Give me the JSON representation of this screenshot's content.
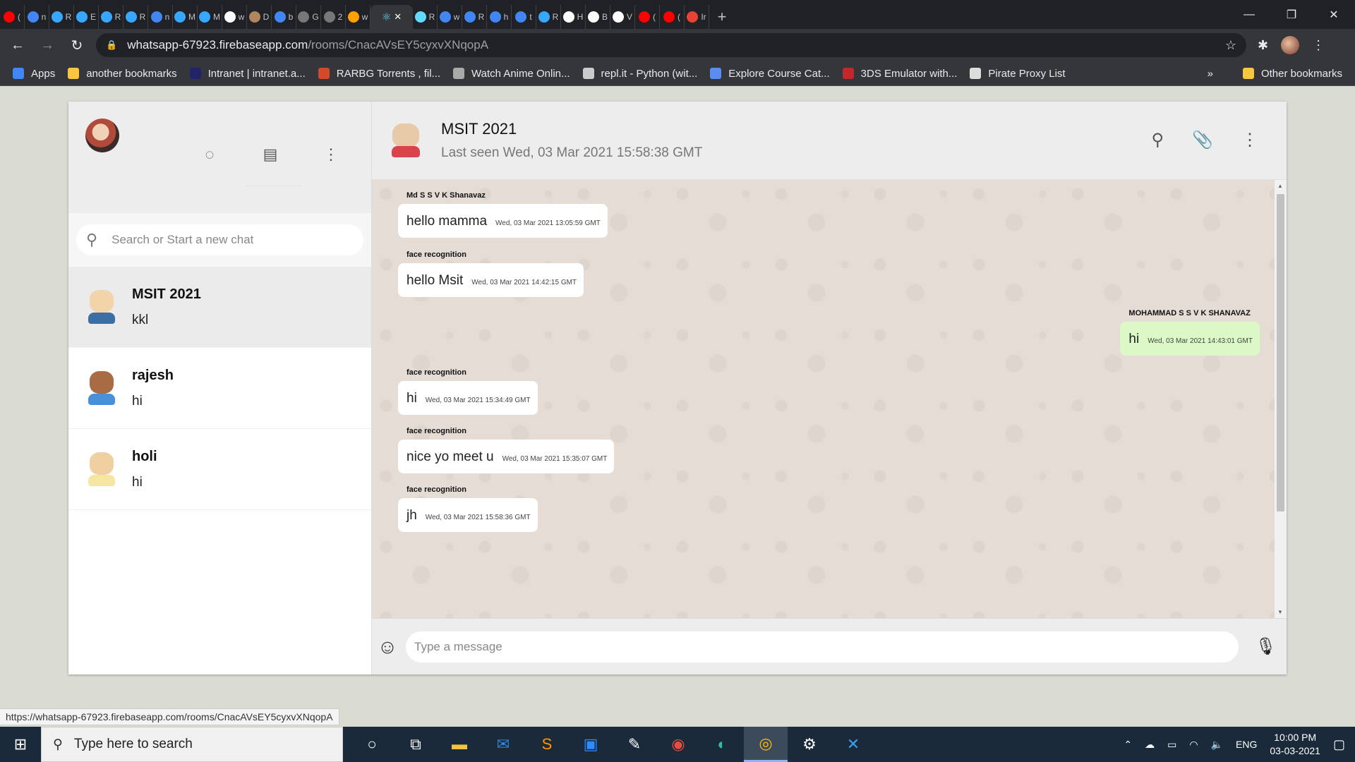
{
  "browser": {
    "tabs": [
      {
        "label": "(",
        "color": "#ff0000"
      },
      {
        "label": "n",
        "color": "#4285f4"
      },
      {
        "label": "R",
        "color": "#36a8ff"
      },
      {
        "label": "E",
        "color": "#36a8ff"
      },
      {
        "label": "R",
        "color": "#36a8ff"
      },
      {
        "label": "R",
        "color": "#36a8ff"
      },
      {
        "label": "n",
        "color": "#4285f4"
      },
      {
        "label": "M",
        "color": "#36a8ff"
      },
      {
        "label": "M",
        "color": "#36a8ff"
      },
      {
        "label": "w",
        "color": "#ffffff"
      },
      {
        "label": "D",
        "color": "#b0855f"
      },
      {
        "label": "b",
        "color": "#4285f4"
      },
      {
        "label": "G",
        "color": "#777777"
      },
      {
        "label": "2",
        "color": "#777777"
      },
      {
        "label": "w",
        "color": "#ffa000"
      }
    ],
    "active_tab": {
      "icon": "react-icon",
      "close": "✕"
    },
    "tabs_after": [
      {
        "label": "R",
        "color": "#61dafb"
      },
      {
        "label": "w",
        "color": "#4285f4"
      },
      {
        "label": "R",
        "color": "#4285f4"
      },
      {
        "label": "h",
        "color": "#4285f4"
      },
      {
        "label": "t",
        "color": "#4285f4"
      },
      {
        "label": "R",
        "color": "#36a8ff"
      },
      {
        "label": "H",
        "color": "#ffffff"
      },
      {
        "label": "B",
        "color": "#ffffff"
      },
      {
        "label": "V",
        "color": "#ffffff"
      },
      {
        "label": "(",
        "color": "#ff0000"
      },
      {
        "label": "(",
        "color": "#ff0000"
      },
      {
        "label": "Ir",
        "color": "#ea4335"
      }
    ],
    "new_tab": "+",
    "window_controls": [
      "—",
      "❐",
      "✕"
    ],
    "url_host": "whatsapp-67923.firebaseapp.com",
    "url_path": "/rooms/CnacAVsEY5cyxvXNqopA",
    "bookmarks": [
      {
        "label": "Apps",
        "color": "#4285f4"
      },
      {
        "label": "another bookmarks",
        "color": "#f9c642"
      },
      {
        "label": "Intranet | intranet.a...",
        "color": "#222266"
      },
      {
        "label": "RARBG Torrents , fil...",
        "color": "#d14a2a"
      },
      {
        "label": "Watch Anime Onlin...",
        "color": "#aaaaaa"
      },
      {
        "label": "repl.it - Python (wit...",
        "color": "#cccccc"
      },
      {
        "label": "Explore Course Cat...",
        "color": "#5b8def"
      },
      {
        "label": "3DS Emulator with...",
        "color": "#c0282d"
      },
      {
        "label": "Pirate Proxy List",
        "color": "#dddddd"
      }
    ],
    "bookmarks_more": "»",
    "other_bookmarks": "Other bookmarks",
    "status_url": "https://whatsapp-67923.firebaseapp.com/rooms/CnacAVsEY5cyxvXNqopA"
  },
  "sidebar": {
    "search_placeholder": "Search or Start a new chat",
    "chats": [
      {
        "name": "MSIT 2021",
        "last": "kkl",
        "face": "#f2d4a8",
        "body": "#3a6ea5"
      },
      {
        "name": "rajesh",
        "last": "hi",
        "face": "#a86b43",
        "body": "#4a90d9"
      },
      {
        "name": "holi",
        "last": "hi",
        "face": "#f0d0a0",
        "body": "#f5e6a0"
      }
    ]
  },
  "chat": {
    "name": "MSIT 2021",
    "last_seen": "Last seen Wed, 03 Mar 2021 15:58:38 GMT",
    "messages": [
      {
        "sender": "Md S S V K Shanavaz",
        "text": "hello mamma",
        "time": "Wed, 03 Mar 2021 13:05:59 GMT",
        "mine": false
      },
      {
        "sender": "face recognition",
        "text": "hello Msit",
        "time": "Wed, 03 Mar 2021 14:42:15 GMT",
        "mine": false
      },
      {
        "sender": "MOHAMMAD S S V K SHANAVAZ",
        "text": "hi",
        "time": "Wed, 03 Mar 2021 14:43:01 GMT",
        "mine": true
      },
      {
        "sender": "face recognition",
        "text": "hi",
        "time": "Wed, 03 Mar 2021 15:34:49 GMT",
        "mine": false
      },
      {
        "sender": "face recognition",
        "text": "nice yo meet u",
        "time": "Wed, 03 Mar 2021 15:35:07 GMT",
        "mine": false
      },
      {
        "sender": "face recognition",
        "text": "jh",
        "time": "Wed, 03 Mar 2021 15:58:36 GMT",
        "mine": false
      }
    ],
    "composer_placeholder": "Type a message"
  },
  "taskbar": {
    "search_placeholder": "Type here to search",
    "lang": "ENG",
    "time": "10:00 PM",
    "date": "03-03-2021"
  }
}
